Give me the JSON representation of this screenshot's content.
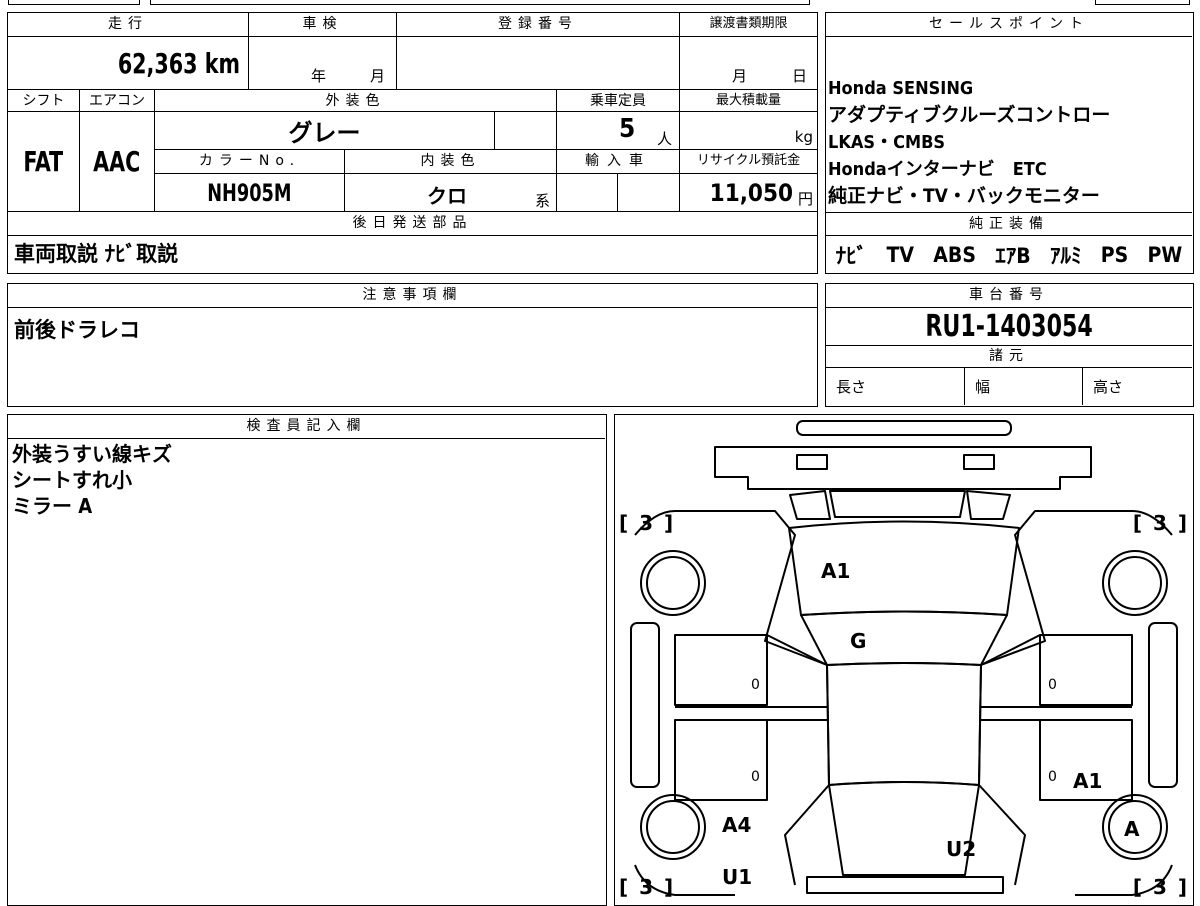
{
  "header": {
    "mileage_label": "走行",
    "mileage_value": "62,363 km",
    "shaken_label": "車検",
    "shaken_year": "年",
    "shaken_month": "月",
    "reg_label": "登録番号",
    "transfer_label": "譲渡書類期限",
    "transfer_month": "月",
    "transfer_day": "日",
    "shift_label": "シフト",
    "shift_value": "FAT",
    "ac_label": "エアコン",
    "ac_value": "AAC",
    "ext_color_label": "外装色",
    "ext_color_value": "グレー",
    "capacity_label": "乗車定員",
    "capacity_value": "5",
    "capacity_unit": "人",
    "maxload_label": "最大積載量",
    "maxload_unit": "kg",
    "color_no_label": "カラーNo.",
    "color_no_value": "NH905M",
    "int_color_label": "内装色",
    "int_color_value": "クロ",
    "int_color_suffix": "系",
    "import_label": "輸入車",
    "recycle_label": "リサイクル預託金",
    "recycle_value": "11,050",
    "recycle_unit": "円",
    "shipping_label": "後日発送部品",
    "shipping_value": "車両取説 ﾅﾋﾞ取説"
  },
  "sales": {
    "label": "セールスポイント",
    "lines": [
      "Honda SENSING",
      "アダプティブクルーズコントロー",
      "LKAS・CMBS",
      "Hondaインターナビ　ETC",
      "純正ナビ・TV・バックモニター"
    ],
    "equip_label": "純正装備",
    "equip_items": [
      "ﾅﾋﾞ",
      "TV",
      "ABS",
      "ｴｱB",
      "ｱﾙﾐ",
      "PS",
      "PW"
    ]
  },
  "notes": {
    "label": "注意事項欄",
    "value": "前後ドラレコ"
  },
  "chassis": {
    "label": "車台番号",
    "value": "RU1-1403054",
    "specs_label": "諸元",
    "length_label": "長さ",
    "width_label": "幅",
    "height_label": "高さ"
  },
  "inspector": {
    "label": "検査員記入欄",
    "lines": [
      "外装うすい線キズ",
      "シートすれ小",
      "ミラー A"
    ]
  },
  "diagram": {
    "tires": {
      "fl": "[ 3 ]",
      "fr": "[ 3 ]",
      "rl": "[ 3 ]",
      "rr": "[ 3 ]"
    },
    "marks": {
      "bonnet": "A1",
      "windshield": "G",
      "left_front_door": "0",
      "left_rear_door": "0",
      "right_front_door": "0",
      "right_rear_door": "0",
      "right_rear_door_mark": "A1",
      "right_rear_wheel": "A",
      "left_rear_fender": "A4",
      "left_rear_quarter": "U1",
      "roof_rear": "U2"
    }
  }
}
